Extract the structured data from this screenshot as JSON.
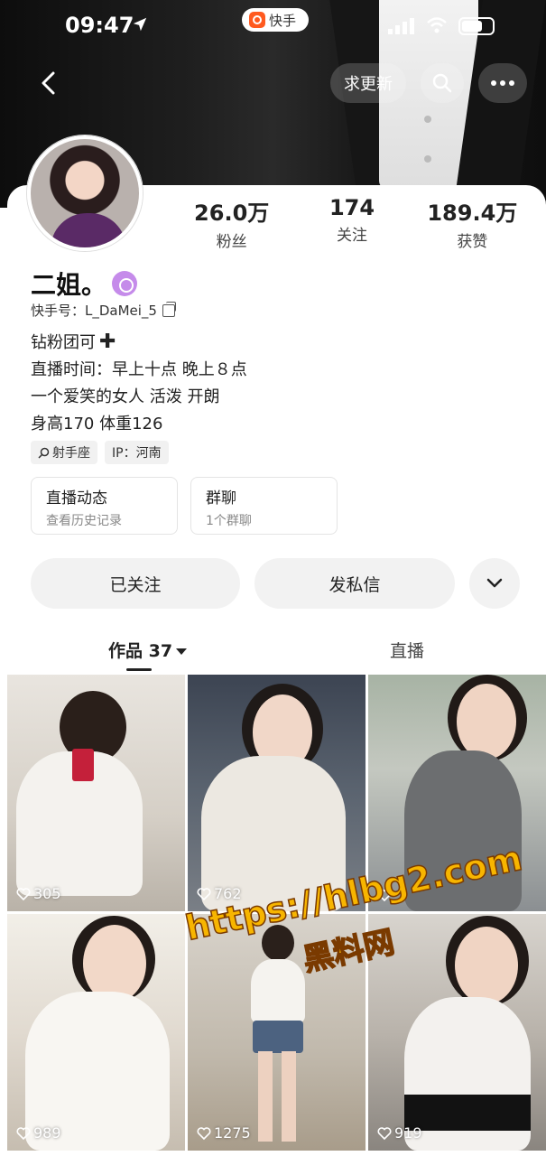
{
  "status_bar": {
    "time": "09:47",
    "app_pill": "快手"
  },
  "nav": {
    "update_label": "求更新"
  },
  "profile": {
    "name": "二姐。",
    "kuaishou_id": "快手号：L_DaMei_5",
    "stats": [
      {
        "value": "26.0万",
        "label": "粉丝"
      },
      {
        "value": "174",
        "label": "关注"
      },
      {
        "value": "189.4万",
        "label": "获赞"
      }
    ],
    "bio": [
      "钻粉团可",
      "直播时间：早上十点 晚上８点",
      "一个爱笑的女人 活泼 开朗",
      "身高170 体重126"
    ],
    "tags": [
      "射手座",
      "IP：河南"
    ],
    "entries": [
      {
        "title": "直播动态",
        "subtitle": "查看历史记录"
      },
      {
        "title": "群聊",
        "subtitle": "1个群聊"
      }
    ]
  },
  "actions": {
    "follow_label": "已关注",
    "message_label": "发私信"
  },
  "tabs": {
    "works_label": "作品",
    "works_count": "37",
    "live_label": "直播"
  },
  "grid": [
    {
      "likes": "305"
    },
    {
      "likes": "762"
    },
    {
      "likes": ""
    },
    {
      "likes": "989"
    },
    {
      "likes": "1275"
    },
    {
      "likes": "919"
    }
  ],
  "watermark": {
    "url": "https://hlbg2.com",
    "name": "黑料网"
  },
  "colors": {
    "accent_orange": "#ff5a1f",
    "watermark_yellow": "#f7b500"
  }
}
